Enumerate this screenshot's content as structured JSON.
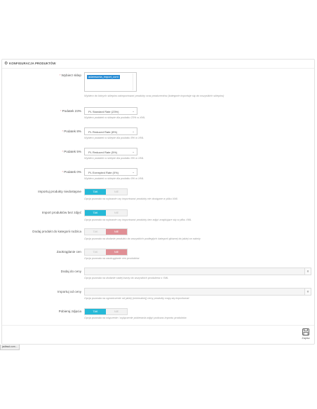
{
  "panel": {
    "title": "KONFIGURACJA PRODUKTÓW",
    "icon": "gear-icon"
  },
  "fields": {
    "stores": {
      "label": "Wybierz sklep",
      "options": [
        "adamsonia_import_cont"
      ],
      "help": "Wybierz do których sklepów zaimportować produkty oraz producentów (kategorie importuje się do wszystkich sklepów)"
    },
    "vat23": {
      "label": "Podatek 23%",
      "value": "PL Standard Rate (23%)",
      "help": "Wybierz podatek w sklepie dla podatku 23% w XML"
    },
    "vat8": {
      "label": "Podatek 8%",
      "value": "PL Reduced Rate (8%)",
      "help": "Wybierz podatek w sklepie dla podatku 8% w XML"
    },
    "vat5": {
      "label": "Podatek 5%",
      "value": "PL Reduced Rate (5%)",
      "help": "Wybierz podatek w sklepie dla podatku 5% w XML"
    },
    "vat0": {
      "label": "Podatek 0%",
      "value": "PL Exempted Rate (0%)",
      "help": "Wybierz podatek w sklepie dla podatku 0% w XML"
    },
    "import_unavailable": {
      "label": "Importuj produkty niedostępne",
      "help": "Opcja pozwala na wybranie czy importować produkty nie dostępne w pliku XML"
    },
    "import_no_images": {
      "label": "Import produktów bez zdjęć",
      "help": "Opcja pozwala na wybranie czy importować produkty bez zdjęć znajdujące się w pliku XML"
    },
    "add_to_parent": {
      "label": "Dodaj produkt do kategorii rodzica",
      "help": "Opcja pozwala na dodanie produktu do wszystkich podległych kategorii głównej do jakiej on należy"
    },
    "round_prices": {
      "label": "Zaokrąglanie cen",
      "help": "Opcja pozwala na zaokrąglanie cen produktów"
    },
    "add_to_prices": {
      "label": "Dodaj do ceny",
      "value": "",
      "addon": "#",
      "help": "Opcja pozwala na dodanie stałej kwoty do wszystkich produktów z XML"
    },
    "subtract_prices": {
      "label": "Importuj od ceny",
      "value": "",
      "addon": "#",
      "help": "Opcja pozwala na ograniczenie od jakiej (minimalnej) ceny produkty mają się importować"
    },
    "download_images": {
      "label": "Pobieraj zdjęcia",
      "help": "Opcja pozwala na włączenie / wyłączenie pobierania zdjęć podczas importu produktów"
    }
  },
  "switch": {
    "yes": "TAK",
    "no": "NIE"
  },
  "switch_states": {
    "import_unavailable": "TAK",
    "import_no_images": "TAK",
    "add_to_parent": "NIE",
    "round_prices": "NIE",
    "download_images": "TAK"
  },
  "footer": {
    "save_label": "Zapisz"
  },
  "statusbar": {
    "text": "jsdfasd.com..."
  },
  "colors": {
    "accent": "#25b9d7",
    "danger": "#e08f95",
    "selected_option": "#2a8dd4"
  }
}
